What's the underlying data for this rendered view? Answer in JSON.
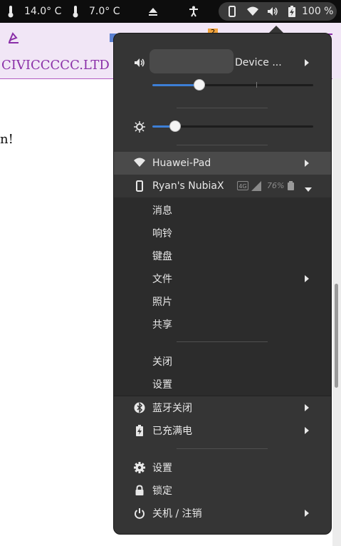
{
  "topbar": {
    "temp1": "14.0° C",
    "temp2": "7.0° C",
    "battery_text": "100 %"
  },
  "background": {
    "site_title": "CIVICCCCC.LTD",
    "body_fragment": "n!",
    "badge_count": "2"
  },
  "menu": {
    "volume": {
      "device_label": "Device ...",
      "level": 0.29
    },
    "brightness": {
      "level": 0.14
    },
    "wifi": {
      "label": "Huawei-Pad"
    },
    "phone": {
      "label": "Ryan's NubiaX",
      "network": "4G",
      "battery": "76%",
      "items": [
        "消息",
        "响铃",
        "键盘",
        "文件",
        "照片",
        "共享"
      ],
      "actions": [
        "关闭",
        "设置"
      ]
    },
    "bluetooth": {
      "label": "蓝牙关闭"
    },
    "power": {
      "label": "已充满电"
    },
    "settings": {
      "label": "设置"
    },
    "lock": {
      "label": "锁定"
    },
    "shutdown": {
      "label": "关机 / 注销"
    }
  },
  "colors": {
    "accent": "#3d7fd6",
    "menu_bg": "#353535",
    "link": "#8a2fa8"
  }
}
